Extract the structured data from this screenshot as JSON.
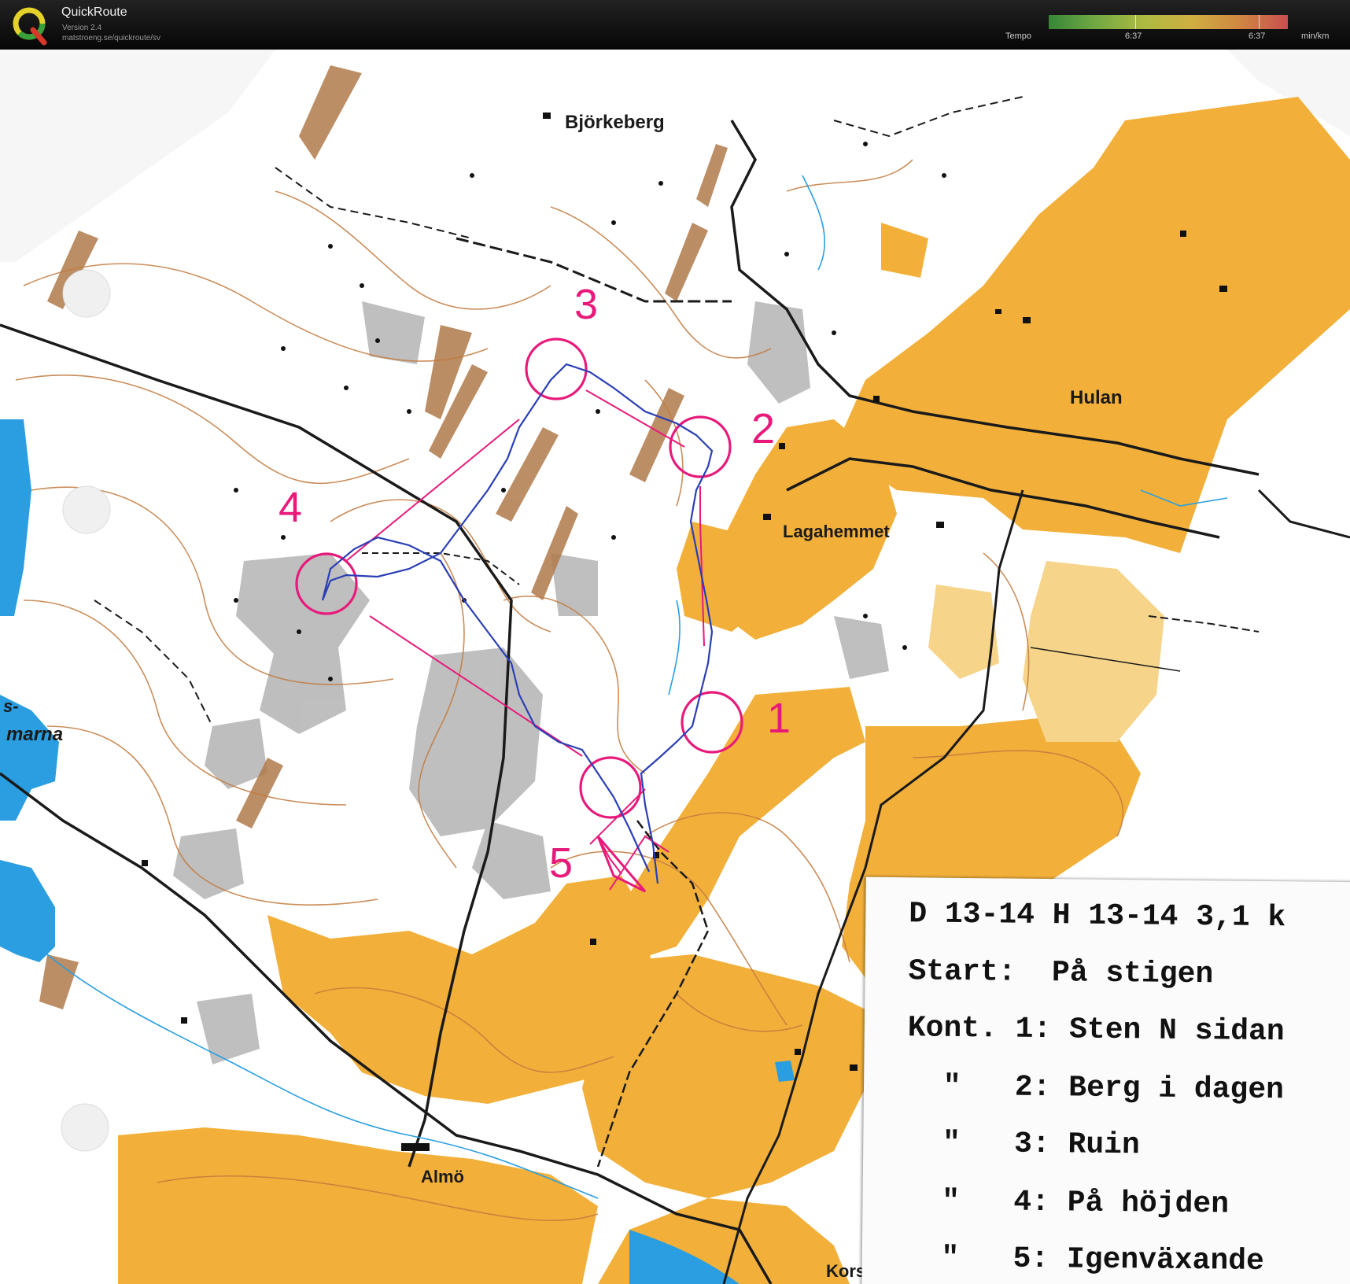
{
  "app": {
    "title": "QuickRoute",
    "version": "Version 2.4",
    "url": "matstroeng.se/quickroute/sv"
  },
  "tempo": {
    "label": "Tempo",
    "value_1": "6:37",
    "value_2": "6:37",
    "unit": "min/km"
  },
  "map": {
    "places": [
      "Björkeberg",
      "Hulan",
      "Lagahemmet",
      "Almö",
      "Kors",
      "s-",
      "marna"
    ],
    "controls": [
      "1",
      "2",
      "3",
      "4",
      "5"
    ],
    "colors": {
      "open_land": "#f2b03a",
      "water": "#2a9ee0",
      "contour": "#b86a2c",
      "course": "#e8197a",
      "route": "#2b3fb5",
      "rock": "#9d9d9d"
    }
  },
  "legend": {
    "header": "D 13-14 H 13-14 3,1 k",
    "start": "Start:  På stigen",
    "c1": "Kont. 1: Sten N sidan",
    "c2": "  \"   2: Berg i dagen",
    "c3": "  \"   3: Ruin",
    "c4": "  \"   4: På höjden",
    "c5": "  \"   5: Igenväxande"
  }
}
